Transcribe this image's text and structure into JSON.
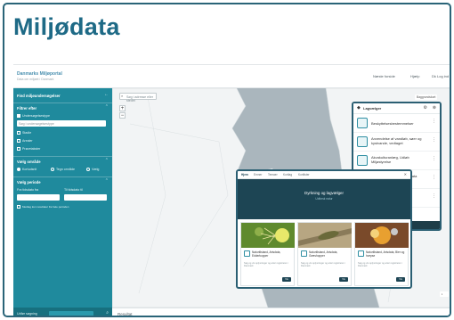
{
  "headline": "Miljødata",
  "app": {
    "brand": "Danmarks Miljøportal",
    "brand_sub": "Data om miljøet i Danmark",
    "nav": [
      "Næste forside",
      "Hjælp",
      "Dk Log ind"
    ]
  },
  "sidebar": {
    "find_title": "Find miljøundersøgelser",
    "filter_title": "Filtrer efter",
    "filter_items": [
      "Undersøgelsestype",
      "Søg i undersøgelsestype",
      "Stadie",
      "Arealer",
      "Prøvetakster"
    ],
    "area_title": "Vælg område",
    "area_options": [
      "Kortudsnit",
      "Tegn område",
      "Vælg"
    ],
    "period_title": "Vælg periode",
    "period_from": "Fra tidsdato fra",
    "period_to": "Til tidsdato til",
    "period_note": "Medtag kun resultater fra hele perioden",
    "footer_label": "Udfør søgning"
  },
  "map": {
    "search_placeholder": "Søg i adresse eller stedet",
    "layer_chip": "Baggrundskort",
    "zoom_in": "+",
    "zoom_out": "−"
  },
  "layers_panel": {
    "title": "Lagvælger",
    "items": [
      "Beskyttelsesbestemmelser",
      "Anvendelse af vandløb, søer og kystvande, vedtaget",
      "Akvakulturanlæg, Udløb Miljøstyrelse",
      "Akvakulturanlæg, Andre data",
      "Miljøoplysning"
    ]
  },
  "popup": {
    "tabs": [
      "Hjem",
      "Emner",
      "Temaer",
      "Kortlag",
      "Kortlister"
    ],
    "hero_title": "Dyrkning og lagvælger",
    "hero_sub": "Udforsk natur",
    "cards": [
      {
        "title": "Naturtilstand, Artsdata, Edderkopper",
        "text": "Søg og vis oplysninger og arter registreret i Danmark",
        "button": "Vis"
      },
      {
        "title": "Naturtilstand, Artsdata, Græshopper",
        "text": "Søg og vis oplysninger og arter registreret i Danmark",
        "button": "Vis"
      },
      {
        "title": "Naturtilstand, Artsdata, Bier og hvepse",
        "text": "Søg og vis oplysninger og arter registreret i Danmark",
        "button": "Vis"
      }
    ]
  },
  "bottombar": {
    "label": "Resultat"
  },
  "colors": {
    "title": "#1e6a86",
    "sidebar": "#1f8a9d",
    "panel_border": "#2b5f73",
    "hero": "#1d4554",
    "sea": "#aab6bd",
    "land": "#f2f4f5"
  }
}
